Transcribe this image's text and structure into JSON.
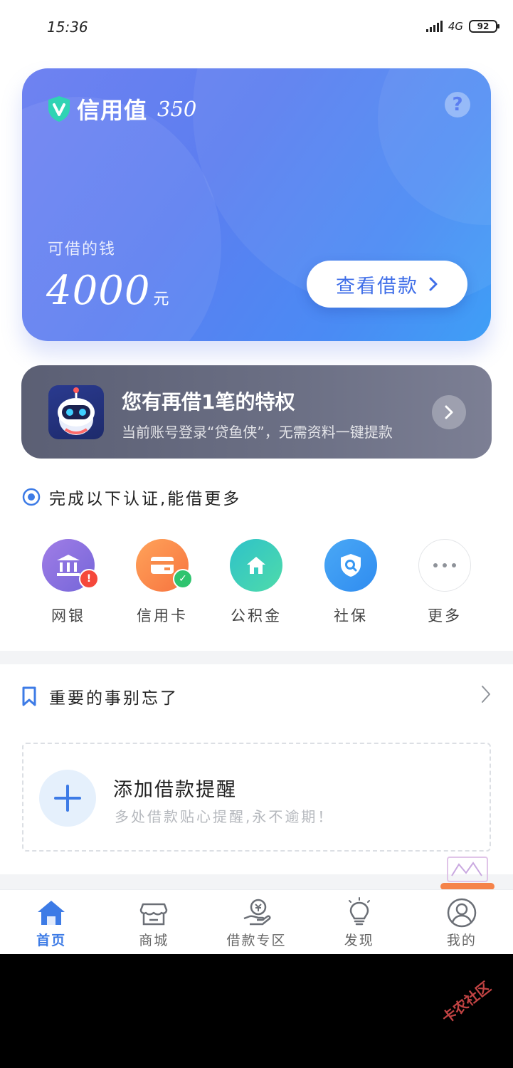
{
  "status_bar": {
    "time": "15:36",
    "network": "4G",
    "battery": "92"
  },
  "credit_card": {
    "title": "信用值",
    "score": "350",
    "help_icon": "question-icon",
    "available_label": "可借的钱",
    "amount": "4000",
    "amount_unit": "元",
    "view_button_label": "查看借款",
    "accent_colors": [
      "#6f82f1",
      "#3f9ff6"
    ]
  },
  "privilege_banner": {
    "title": "您有再借1笔的特权",
    "subtitle": "当前账号登录“贷鱼侠”，无需资料一键提款"
  },
  "certification": {
    "title": "完成以下认证,能借更多",
    "items": [
      {
        "label": "网银",
        "icon": "bank-icon",
        "badge": "alert",
        "color": "#8a6fe0"
      },
      {
        "label": "信用卡",
        "icon": "credit-card-icon",
        "badge": "check",
        "color": "#fb8a4c"
      },
      {
        "label": "公积金",
        "icon": "house-icon",
        "badge": "",
        "color": "#33c8c0"
      },
      {
        "label": "社保",
        "icon": "shield-search-icon",
        "badge": "",
        "color": "#3da2f2"
      },
      {
        "label": "更多",
        "icon": "more-icon",
        "badge": "",
        "color": "#ffffff"
      }
    ]
  },
  "reminder": {
    "title": "重要的事别忘了",
    "add_title": "添加借款提醒",
    "add_subtitle": "多处借款贴心提醒,永不逾期！"
  },
  "tabbar": {
    "items": [
      {
        "label": "首页",
        "icon": "home-icon",
        "active": true
      },
      {
        "label": "商城",
        "icon": "store-icon",
        "active": false
      },
      {
        "label": "借款专区",
        "icon": "loan-hand-icon",
        "active": false
      },
      {
        "label": "发现",
        "icon": "lightbulb-icon",
        "active": false
      },
      {
        "label": "我的",
        "icon": "user-icon",
        "active": false
      }
    ]
  },
  "watermark": "卡农社区"
}
